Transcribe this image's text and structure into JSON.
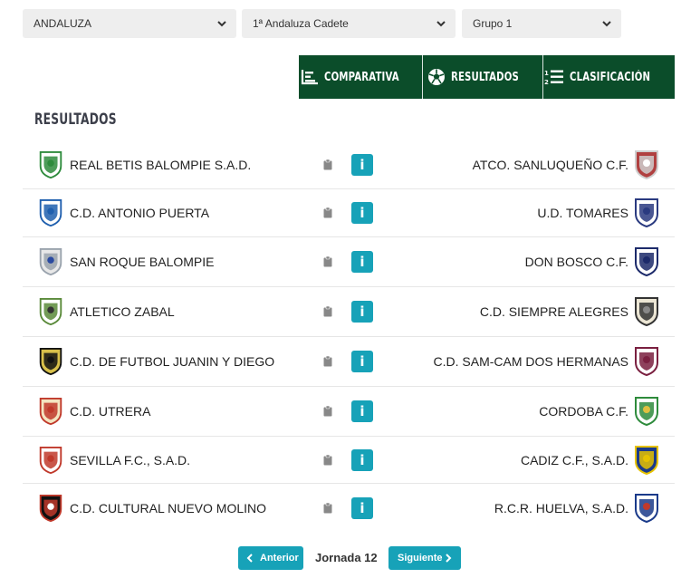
{
  "filters": {
    "region": "ANDALUZA",
    "category": "1ª Andaluza Cadete",
    "group": "Grupo 1"
  },
  "tabs": {
    "comparativa": "COMPARATIVA",
    "resultados": "RESULTADOS",
    "clasificacion": "CLASIFICACIÓN"
  },
  "section_title": "RESULTADOS",
  "matches": [
    {
      "home": "REAL BETIS BALOMPIE S.A.D.",
      "away": "ATCO. SANLUQUEÑO C.F.",
      "home_icon": "betis-crest-icon",
      "away_icon": "sanluqueno-crest-icon"
    },
    {
      "home": "C.D. ANTONIO PUERTA",
      "away": "U.D. TOMARES",
      "home_icon": "antonio-puerta-crest-icon",
      "away_icon": "tomares-crest-icon"
    },
    {
      "home": "SAN ROQUE BALOMPIE",
      "away": "DON BOSCO C.F.",
      "home_icon": "san-roque-crest-icon",
      "away_icon": "don-bosco-crest-icon"
    },
    {
      "home": "ATLETICO ZABAL",
      "away": "C.D. SIEMPRE ALEGRES",
      "home_icon": "zabal-crest-icon",
      "away_icon": "siempre-alegres-crest-icon"
    },
    {
      "home": "C.D. DE FUTBOL JUANIN Y DIEGO",
      "away": "C.D. SAM-CAM DOS HERMANAS",
      "home_icon": "juanin-diego-crest-icon",
      "away_icon": "sam-cam-crest-icon"
    },
    {
      "home": "C.D. UTRERA",
      "away": "CORDOBA C.F.",
      "home_icon": "utrera-crest-icon",
      "away_icon": "cordoba-crest-icon"
    },
    {
      "home": "SEVILLA F.C., S.A.D.",
      "away": "CADIZ C.F., S.A.D.",
      "home_icon": "sevilla-crest-icon",
      "away_icon": "cadiz-crest-icon"
    },
    {
      "home": "C.D. CULTURAL NUEVO MOLINO",
      "away": "R.C.R. HUELVA, S.A.D.",
      "home_icon": "nuevo-molino-crest-icon",
      "away_icon": "huelva-crest-icon"
    }
  ],
  "info_label": "i",
  "pager": {
    "prev": "Anterior",
    "current": "Jornada 12",
    "next": "Siguiente"
  },
  "colors": {
    "tab_bg": "#0b4d2a",
    "button": "#17a2b8",
    "select_bg": "#eeeeee"
  }
}
